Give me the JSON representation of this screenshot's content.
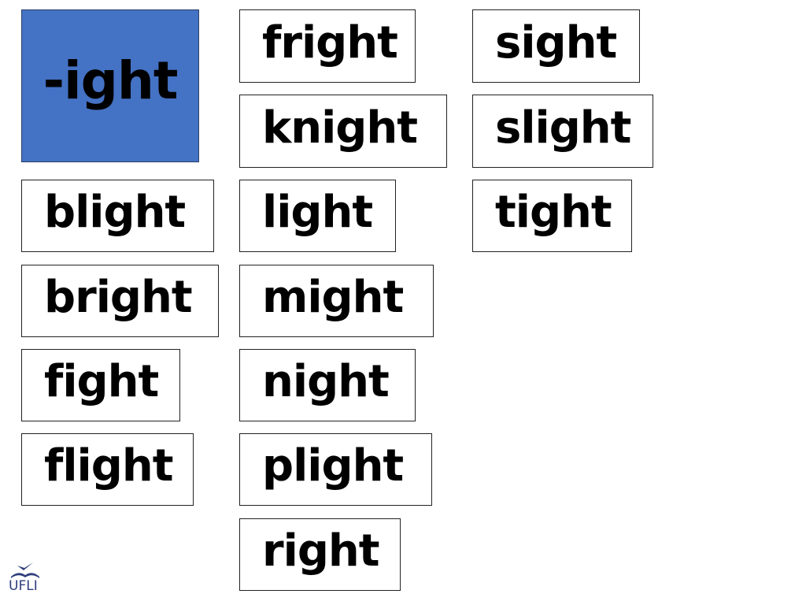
{
  "header": {
    "label": "-ight",
    "color": "#4472C4"
  },
  "column1": [
    "blight",
    "bright",
    "fight",
    "flight"
  ],
  "column2": [
    "fright",
    "knight",
    "light",
    "might",
    "night",
    "plight",
    "right"
  ],
  "column3": [
    "sight",
    "slight",
    "tight"
  ],
  "logo": {
    "text": "UFLI",
    "icon": "open-book-bird-icon",
    "color": "#2e3d7c"
  }
}
